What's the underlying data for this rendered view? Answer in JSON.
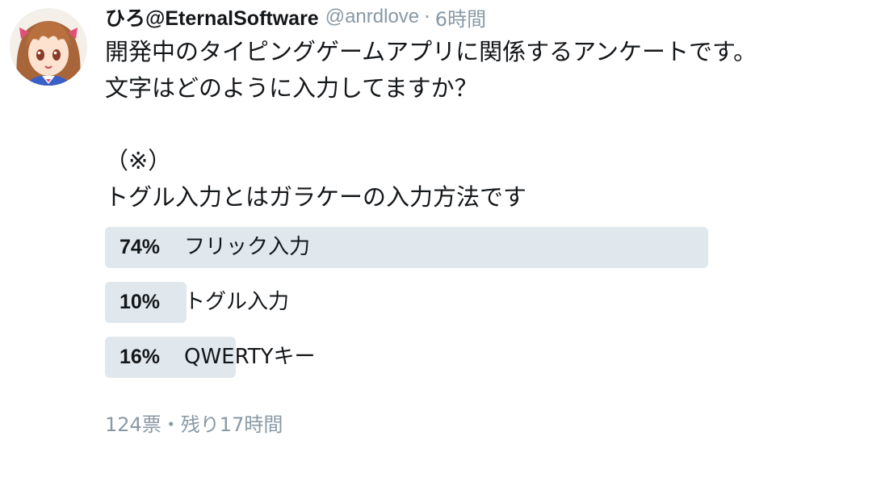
{
  "tweet": {
    "display_name": "ひろ@EternalSoftware",
    "handle": "@anrdlove",
    "separator": "·",
    "timestamp": "6時間",
    "text_lines": [
      "開発中のタイピングゲームアプリに関係するアンケートです。",
      "文字はどのように入力してますか？",
      "",
      "（※）",
      "トグル入力とはガラケーの入力方法です"
    ]
  },
  "poll": {
    "options": [
      {
        "percent_label": "74%",
        "label": "フリック入力",
        "percent": 74
      },
      {
        "percent_label": "10%",
        "label": "トグル入力",
        "percent": 10
      },
      {
        "percent_label": "16%",
        "label": "QWERTYキー",
        "percent": 16
      }
    ],
    "footer": "124票・残り17時間",
    "bar_color": "#e1e8ed"
  },
  "avatar": {
    "icon": "anime-girl-avatar"
  }
}
